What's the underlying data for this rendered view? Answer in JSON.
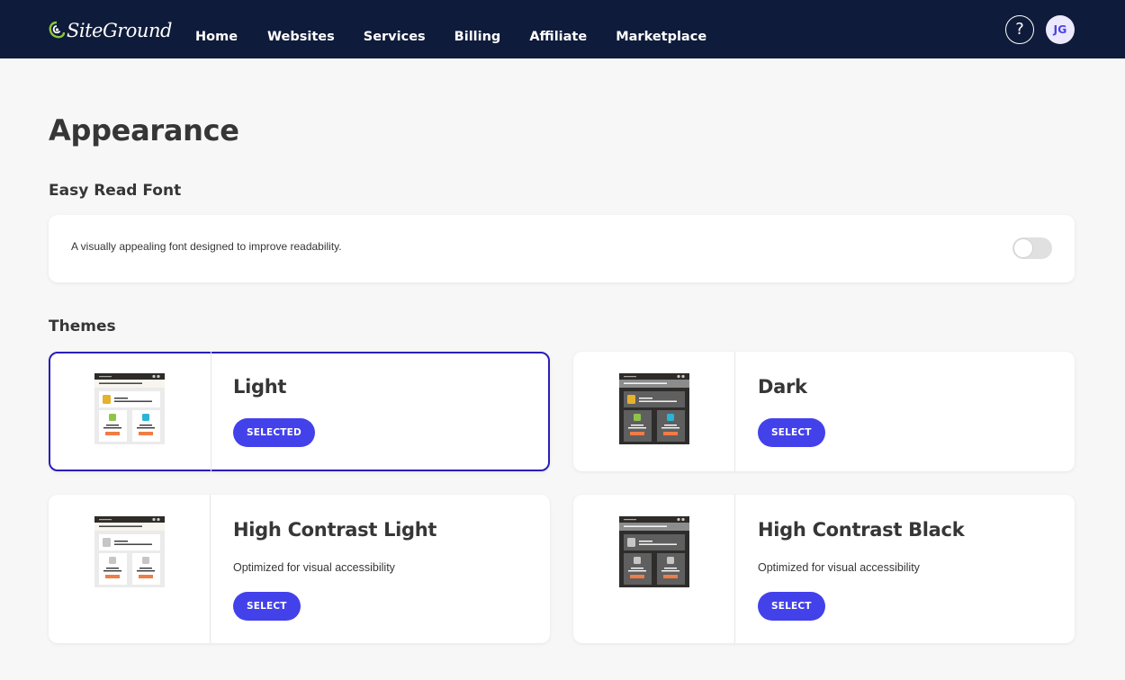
{
  "header": {
    "brand": "SiteGround",
    "nav": [
      "Home",
      "Websites",
      "Services",
      "Billing",
      "Affiliate",
      "Marketplace"
    ],
    "help_icon": "question-circle-icon",
    "help_glyph": "?",
    "avatar_initials": "JG"
  },
  "page": {
    "title": "Appearance",
    "easy_read": {
      "section_title": "Easy Read Font",
      "description": "A visually appealing font designed to improve readability.",
      "enabled": false
    },
    "themes": {
      "section_title": "Themes",
      "items": [
        {
          "name": "Light",
          "description": "",
          "button": "SELECTED",
          "selected": true,
          "preview": "light"
        },
        {
          "name": "Dark",
          "description": "",
          "button": "SELECT",
          "selected": false,
          "preview": "dark"
        },
        {
          "name": "High Contrast Light",
          "description": "Optimized for visual accessibility",
          "button": "SELECT",
          "selected": false,
          "preview": "hc-light"
        },
        {
          "name": "High Contrast Black",
          "description": "Optimized for visual accessibility",
          "button": "SELECT",
          "selected": false,
          "preview": "hc-black"
        }
      ]
    }
  },
  "colors": {
    "nav_bg": "#0f1b3a",
    "accent": "#4341ea",
    "selected_border": "#2a1eb8",
    "logo_green": "#8cc63f"
  }
}
